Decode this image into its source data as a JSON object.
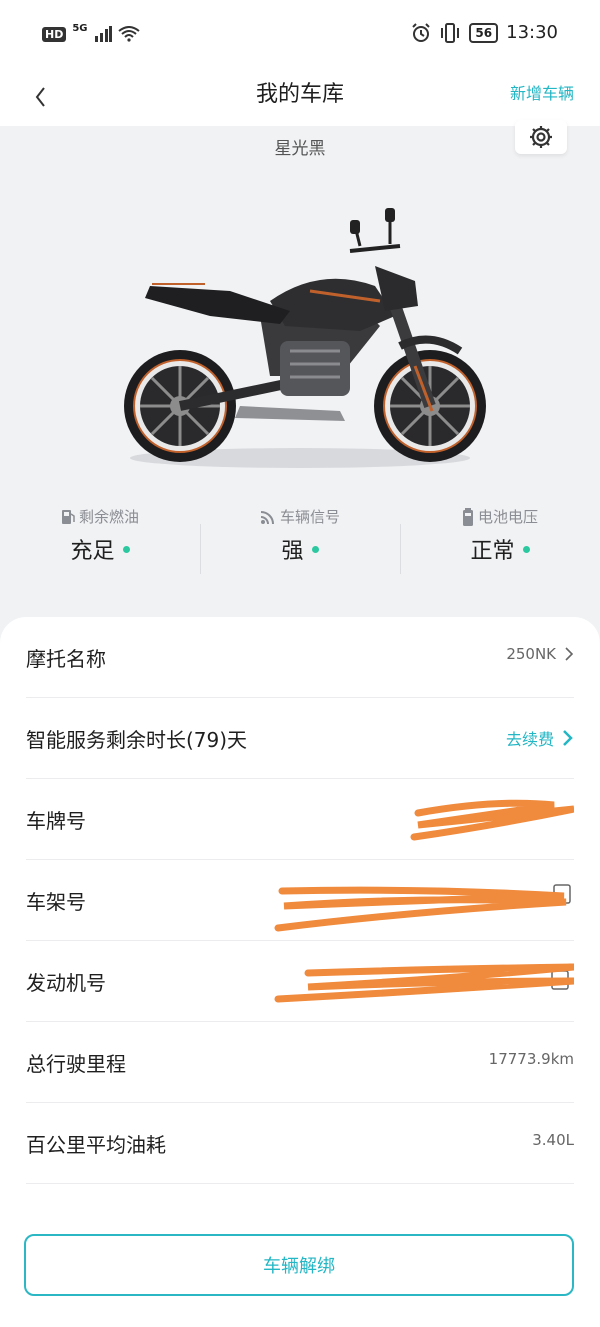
{
  "status_bar": {
    "hd_label": "HD",
    "network": "5G",
    "battery": "56",
    "time": "13:30",
    "icons": [
      "signal-icon",
      "wifi-icon",
      "alarm-icon",
      "vibrate-icon",
      "battery-icon"
    ]
  },
  "header": {
    "title": "我的车库",
    "add_vehicle": "新增车辆",
    "back_icon": "chevron-left-icon"
  },
  "vehicle": {
    "color_name": "星光黑",
    "settings_icon": "gear-icon",
    "image": "motorcycle-image"
  },
  "stats": [
    {
      "label": "剩余燃油",
      "value": "充足",
      "icon": "fuel-icon"
    },
    {
      "label": "车辆信号",
      "value": "强",
      "icon": "signal-wave-icon"
    },
    {
      "label": "电池电压",
      "value": "正常",
      "icon": "battery-icon"
    }
  ],
  "status_dot_color": "#2cc8a0",
  "accent_color": "#23b6c4",
  "details": {
    "name": {
      "label": "摩托名称",
      "value": "250NK"
    },
    "service": {
      "label": "智能服务剩余时长(79)天",
      "action": "去续费"
    },
    "plate": {
      "label": "车牌号"
    },
    "frame": {
      "label": "车架号"
    },
    "engine": {
      "label": "发动机号"
    },
    "mileage": {
      "label": "总行驶里程",
      "value": "17773.9km"
    },
    "fuel_consumption": {
      "label": "百公里平均油耗",
      "value": "3.40L"
    }
  },
  "unbind_button": "车辆解绑"
}
